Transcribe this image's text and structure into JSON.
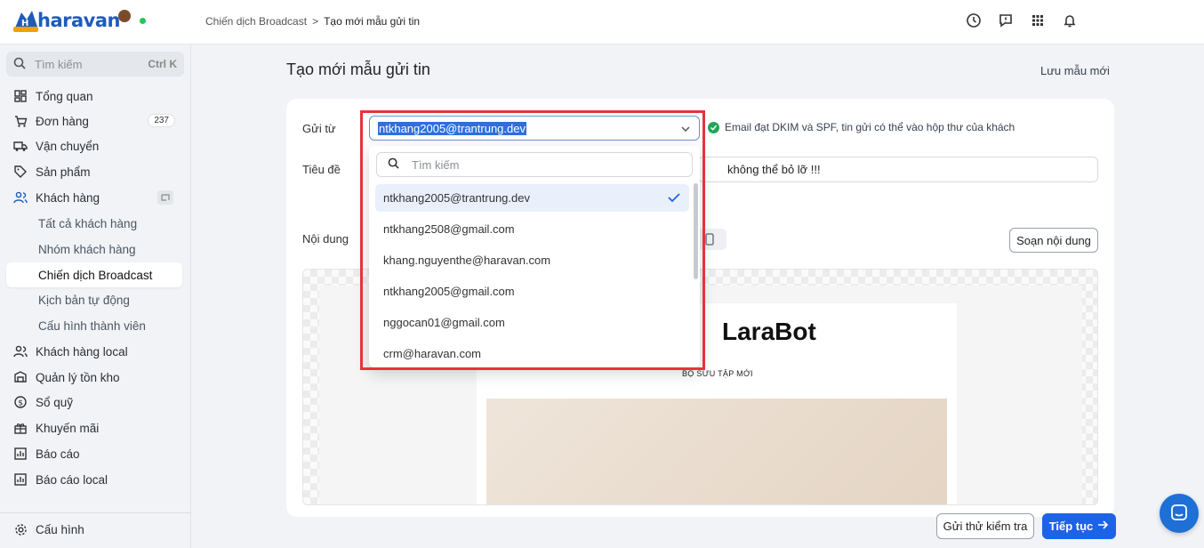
{
  "logo": {
    "text": "haravan"
  },
  "breadcrumb": {
    "parent": "Chiến dịch Broadcast",
    "sep": ">",
    "current": "Tạo mới mẫu gửi tin"
  },
  "sidebar": {
    "search_placeholder": "Tìm kiếm",
    "search_shortcut": "Ctrl K",
    "items": [
      {
        "label": "Tổng quan",
        "icon": "dashboard-icon"
      },
      {
        "label": "Đơn hàng",
        "icon": "cart-icon",
        "badge": "237"
      },
      {
        "label": "Vận chuyển",
        "icon": "truck-icon"
      },
      {
        "label": "Sản phẩm",
        "icon": "tag-icon"
      },
      {
        "label": "Khách hàng",
        "icon": "users-icon"
      },
      {
        "label": "Tất cả khách hàng"
      },
      {
        "label": "Nhóm khách hàng"
      },
      {
        "label": "Chiến dịch Broadcast"
      },
      {
        "label": "Kịch bản tự động"
      },
      {
        "label": "Cấu hình thành viên"
      },
      {
        "label": "Khách hàng local",
        "icon": "users-icon"
      },
      {
        "label": "Quản lý tồn kho",
        "icon": "inventory-icon"
      },
      {
        "label": "Sổ quỹ",
        "icon": "dollar-icon"
      },
      {
        "label": "Khuyến mãi",
        "icon": "gift-icon"
      },
      {
        "label": "Báo cáo",
        "icon": "chart-icon"
      },
      {
        "label": "Báo cáo local",
        "icon": "chart-icon"
      }
    ],
    "settings_label": "Cấu hình"
  },
  "page": {
    "title": "Tạo mới mẫu gửi tin",
    "save_label": "Lưu mẫu mới"
  },
  "form": {
    "from_label": "Gửi từ",
    "from_value": "ntkhang2005@trantrung.dev",
    "verify_text": "Email đạt DKIM và SPF, tin gửi có thể vào hộp thư của khách",
    "subject_label": "Tiêu đề",
    "subject_value": "không thể bỏ lỡ !!!",
    "content_label": "Nội dung",
    "compose_label": "Soạn nội dung"
  },
  "preview": {
    "brand": "LaraBot",
    "subtitle": "BỘ SƯU TẬP MỚI"
  },
  "dropdown": {
    "search_placeholder": "Tìm kiếm",
    "options": [
      "ntkhang2005@trantrung.dev",
      "ntkhang2508@gmail.com",
      "khang.nguyenthe@haravan.com",
      "ntkhang2005@gmail.com",
      "nggocan01@gmail.com",
      "crm@haravan.com"
    ],
    "selected_index": 0
  },
  "footer": {
    "test_label": "Gửi thử kiểm tra",
    "next_label": "Tiếp tục"
  },
  "colors": {
    "primary": "#1d63e8",
    "highlight": "#e5333d",
    "success": "#22a55a"
  }
}
